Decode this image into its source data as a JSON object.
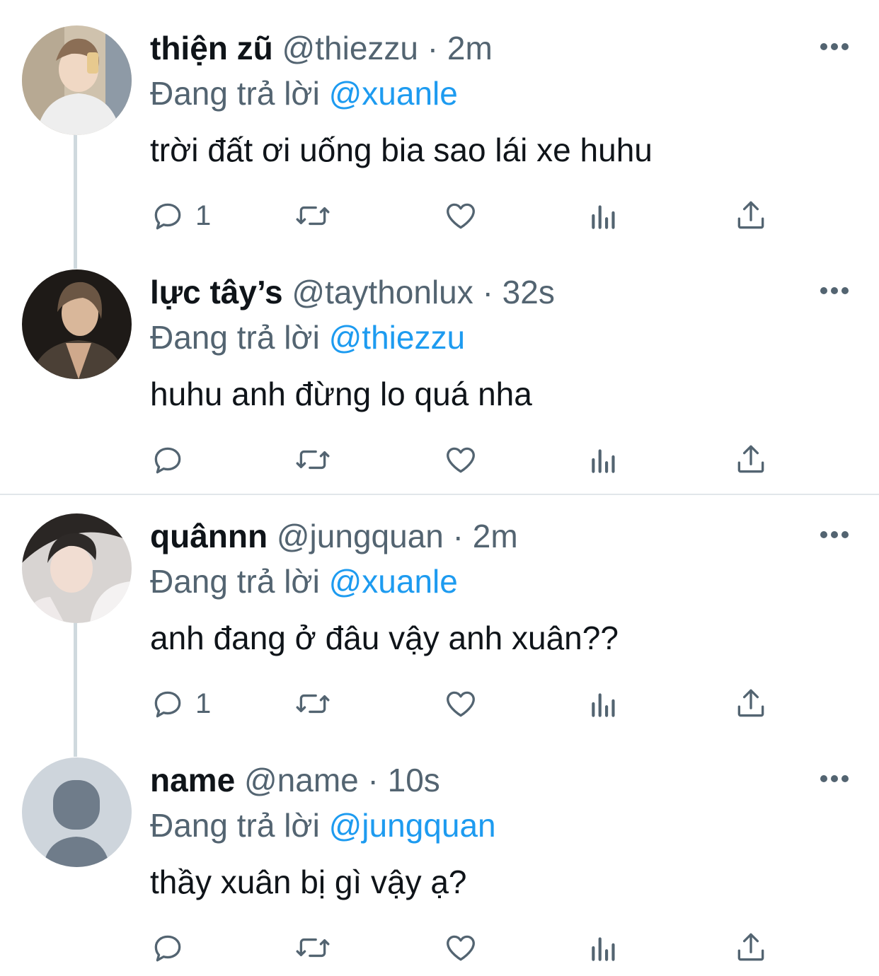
{
  "colors": {
    "text": "#0f1419",
    "muted": "#536471",
    "mention": "#1d9bf0",
    "thread_line": "#cfd9de",
    "divider": "#e1e6ea"
  },
  "tweets": [
    {
      "name": "thiện zũ",
      "handle": "@thiezzu",
      "separator": "·",
      "time": "2m",
      "reply_prefix": "Đang trả lời",
      "reply_to": "@xuanle",
      "text": "trời đất ơi uống bia sao lái xe huhu",
      "reply_count": "1",
      "avatar": "photo-avatar"
    },
    {
      "name": "lực tây’s",
      "handle": "@taythonlux",
      "separator": "·",
      "time": "32s",
      "reply_prefix": "Đang trả lời",
      "reply_to": "@thiezzu",
      "text": "huhu anh đừng lo quá nha",
      "reply_count": "",
      "avatar": "photo-avatar"
    },
    {
      "name": "quânnn",
      "handle": "@jungquan",
      "separator": "·",
      "time": "2m",
      "reply_prefix": "Đang trả lời",
      "reply_to": "@xuanle",
      "text": "anh đang ở đâu vậy anh xuân??",
      "reply_count": "1",
      "avatar": "photo-avatar"
    },
    {
      "name": "name",
      "handle": "@name",
      "separator": "·",
      "time": "10s",
      "reply_prefix": "Đang trả lời",
      "reply_to": "@jungquan",
      "text": "thầy xuân bị gì vậy ạ?",
      "reply_count": "",
      "avatar": "default-person-avatar"
    }
  ],
  "icons": {
    "reply": "reply-icon",
    "retweet": "retweet-icon",
    "like": "heart-icon",
    "views": "analytics-icon",
    "share": "share-icon",
    "more": "more-dots-icon"
  }
}
